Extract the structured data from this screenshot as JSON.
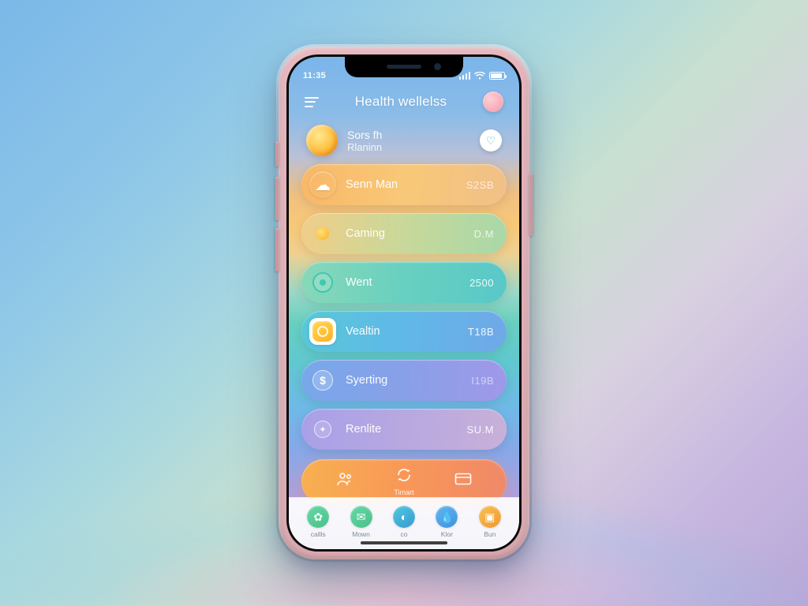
{
  "status": {
    "left": "11:35",
    "icons": {
      "signal": "signal-icon",
      "wifi": "wifi-icon",
      "battery": "battery-icon"
    }
  },
  "header": {
    "title": "Health wellelss",
    "menu_icon": "menu-icon",
    "avatar_icon": "avatar-icon"
  },
  "feature": {
    "icon": "sun-icon",
    "line1": "Sors fh",
    "line2": "Rlaninn",
    "badge_icon": "heart-icon"
  },
  "rows": [
    {
      "icon": "cloud-icon",
      "label": "Senn Man",
      "value": "S2SB"
    },
    {
      "icon": "sunrise-icon",
      "label": "Caming",
      "value": "D.M"
    },
    {
      "icon": "target-icon",
      "label": "Went",
      "value": "2500"
    },
    {
      "icon": "weather-icon",
      "label": "Vealtin",
      "value": "T18B"
    },
    {
      "icon": "coin-icon",
      "label": "Syerting",
      "value": "I19B"
    },
    {
      "icon": "gem-icon",
      "label": "Renlite",
      "value": "SU.M"
    }
  ],
  "cta": {
    "items": [
      {
        "icon": "people-icon",
        "label": ""
      },
      {
        "icon": "refresh-icon",
        "label": "Timart"
      },
      {
        "icon": "card-icon",
        "label": ""
      }
    ]
  },
  "tabs": [
    {
      "icon": "leaf-icon",
      "label": "callls",
      "color": "tc1"
    },
    {
      "icon": "chat-icon",
      "label": "Mown",
      "color": "tc2"
    },
    {
      "icon": "drop-icon",
      "label": "co",
      "color": "tc3"
    },
    {
      "icon": "water-icon",
      "label": "Klor",
      "color": "tc4"
    },
    {
      "icon": "flame-icon",
      "label": "Bun",
      "color": "tc5"
    }
  ],
  "colors": {
    "accent_orange": "#f8a050",
    "accent_teal": "#50c8c0",
    "accent_blue": "#70a8e8"
  }
}
